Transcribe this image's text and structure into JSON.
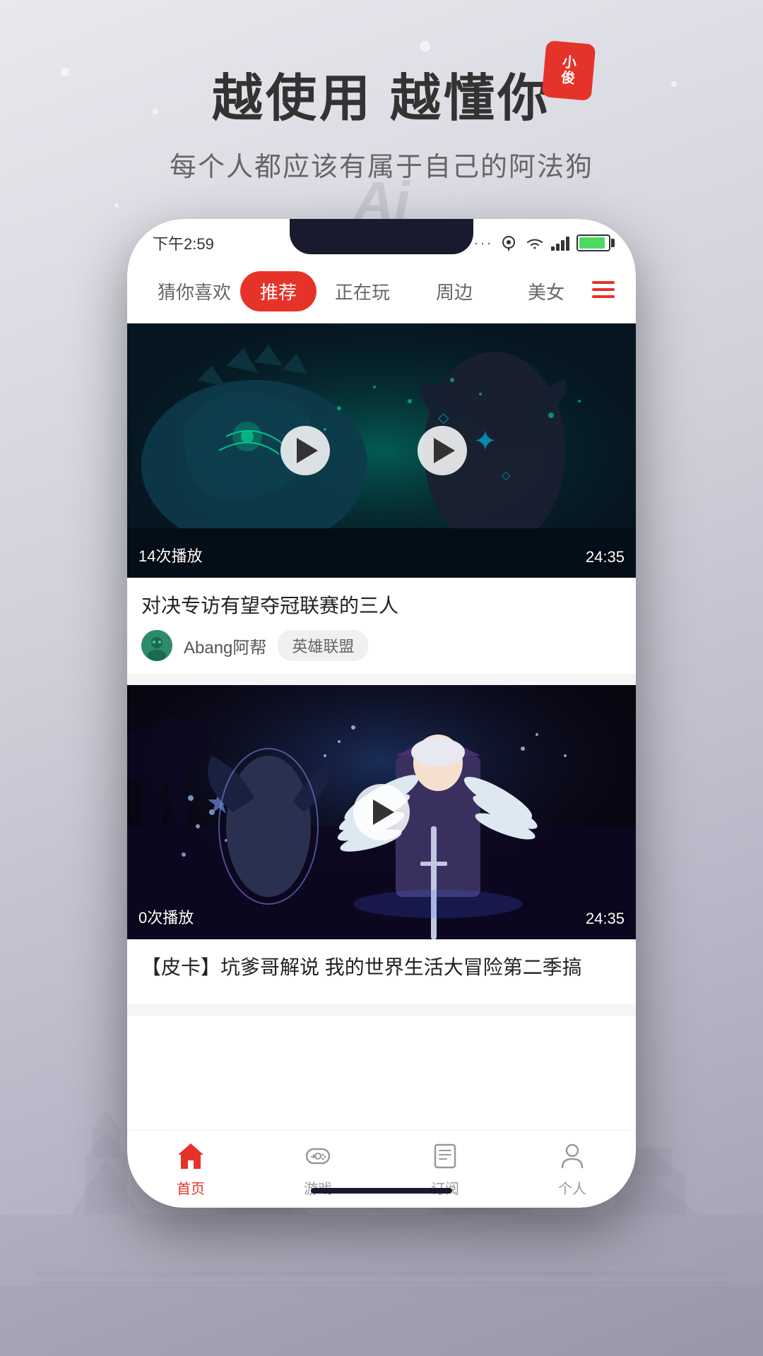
{
  "header": {
    "main_title": "越使用  越懂你",
    "badge_text_line1": "小",
    "badge_text_line2": "俊",
    "sub_title": "每个人都应该有属于自己的阿法狗"
  },
  "status_bar": {
    "time": "下午2:59",
    "signal_dots": "...",
    "battery_label": "battery"
  },
  "nav_tabs": [
    {
      "label": "猜你喜欢",
      "active": false
    },
    {
      "label": "推荐",
      "active": true
    },
    {
      "label": "正在玩",
      "active": false
    },
    {
      "label": "周边",
      "active": false
    },
    {
      "label": "美女",
      "active": false
    }
  ],
  "video_cards": [
    {
      "play_count": "14次播放",
      "duration": "24:35",
      "title": "对决专访有望夺冠联赛的三人",
      "channel": "Abang阿帮",
      "tag": "英雄联盟",
      "thumb_type": "game1"
    },
    {
      "play_count": "0次播放",
      "duration": "24:35",
      "title": "【皮卡】坑爹哥解说 我的世界生活大冒险第二季搞",
      "channel": "",
      "tag": "",
      "thumb_type": "game2"
    }
  ],
  "bottom_nav": [
    {
      "label": "首页",
      "active": true,
      "icon": "home"
    },
    {
      "label": "游戏",
      "active": false,
      "icon": "game"
    },
    {
      "label": "订阅",
      "active": false,
      "icon": "subscribe"
    },
    {
      "label": "个人",
      "active": false,
      "icon": "person"
    }
  ],
  "ai_text": "Ai",
  "colors": {
    "accent": "#e63329",
    "active_nav": "#e63329",
    "text_dark": "#222222",
    "text_mid": "#666666",
    "text_light": "#999999"
  }
}
